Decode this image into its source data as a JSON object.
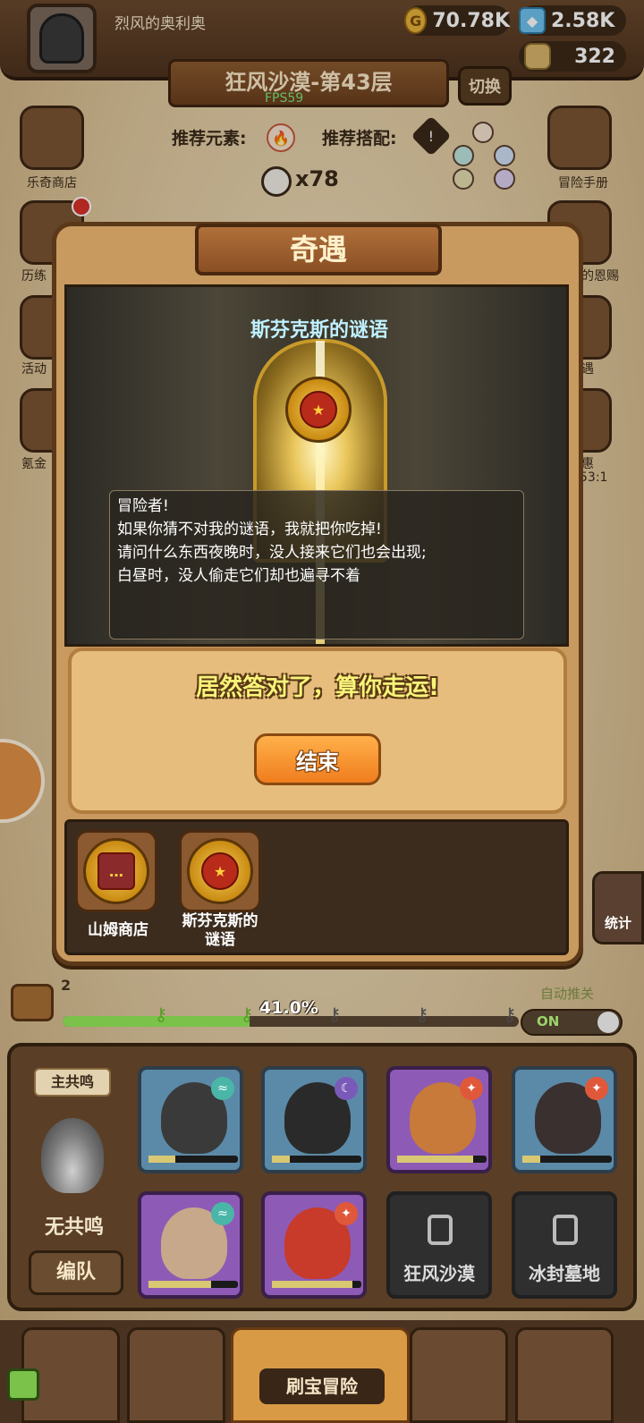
{
  "player": {
    "name": "烈风的奥利奥"
  },
  "resources": {
    "gold": "70.78K",
    "gems": "2.58K",
    "jar": "322"
  },
  "level": {
    "title": "狂风沙漠-第43层",
    "fps": "FPS59",
    "switch_label": "切换",
    "recommend_element_label": "推荐元素:",
    "recommend_combo_label": "推荐搭配:",
    "skull_count": "x78"
  },
  "side_left": [
    {
      "label": "乐奇商店",
      "icon": "clover-shop-icon"
    },
    {
      "label": "历练",
      "icon": "trial-icon"
    },
    {
      "label": "活动",
      "icon": "event-icon"
    },
    {
      "label": "氪金",
      "icon": "diamond-icon"
    }
  ],
  "side_right": [
    {
      "label": "冒险手册",
      "icon": "scroll-icon"
    },
    {
      "label": "的恩赐",
      "icon": "gift-icon"
    },
    {
      "label": "遇",
      "icon": "encounter-icon"
    },
    {
      "label": "惠",
      "icon": "discount-icon"
    }
  ],
  "side_right_note": "53:1",
  "modal": {
    "title": "奇遇",
    "scene_title": "斯芬克斯的谜语",
    "dialog_lines": [
      "冒险者!",
      "如果你猜不对我的谜语，我就把你吃掉!",
      "请问什么东西夜晚时，没人接来它们也会出现;",
      "白昼时，没人偷走它们却也遍寻不着"
    ],
    "result_text": "居然答对了，算你走运!",
    "end_button": "结束",
    "history": [
      {
        "label": "山姆商店",
        "icon": "sam-shop-icon"
      },
      {
        "label_line1": "斯芬克斯的",
        "label_line2": "谜语",
        "icon": "sphinx-icon"
      }
    ]
  },
  "stats_label": "统计",
  "progress": {
    "chest_count": "2",
    "percent_text": "41.0%",
    "percent": 41.0,
    "auto_label": "自动推关",
    "toggle_label": "ON"
  },
  "team": {
    "resonance_label": "主共鸣",
    "no_resonance": "无共鸣",
    "formation_button": "编队",
    "heroes": [
      {
        "name": "knight-hero",
        "element": "wind"
      },
      {
        "name": "hooded-hero",
        "element": "moon"
      },
      {
        "name": "turban-hero",
        "element": "fire"
      },
      {
        "name": "pirate-hero",
        "element": "fire"
      },
      {
        "name": "scar-hero",
        "element": "wind"
      },
      {
        "name": "demon-hero",
        "element": "fire"
      }
    ],
    "locked": [
      {
        "label": "狂风沙漠"
      },
      {
        "label": "冰封墓地"
      }
    ]
  },
  "bottom_nav": {
    "active_label": "刷宝冒险"
  },
  "colors": {
    "fire": "#e0583a",
    "wind": "#4ab6a8",
    "moon": "#7a5ab8",
    "accent_orange": "#f07d1e"
  }
}
